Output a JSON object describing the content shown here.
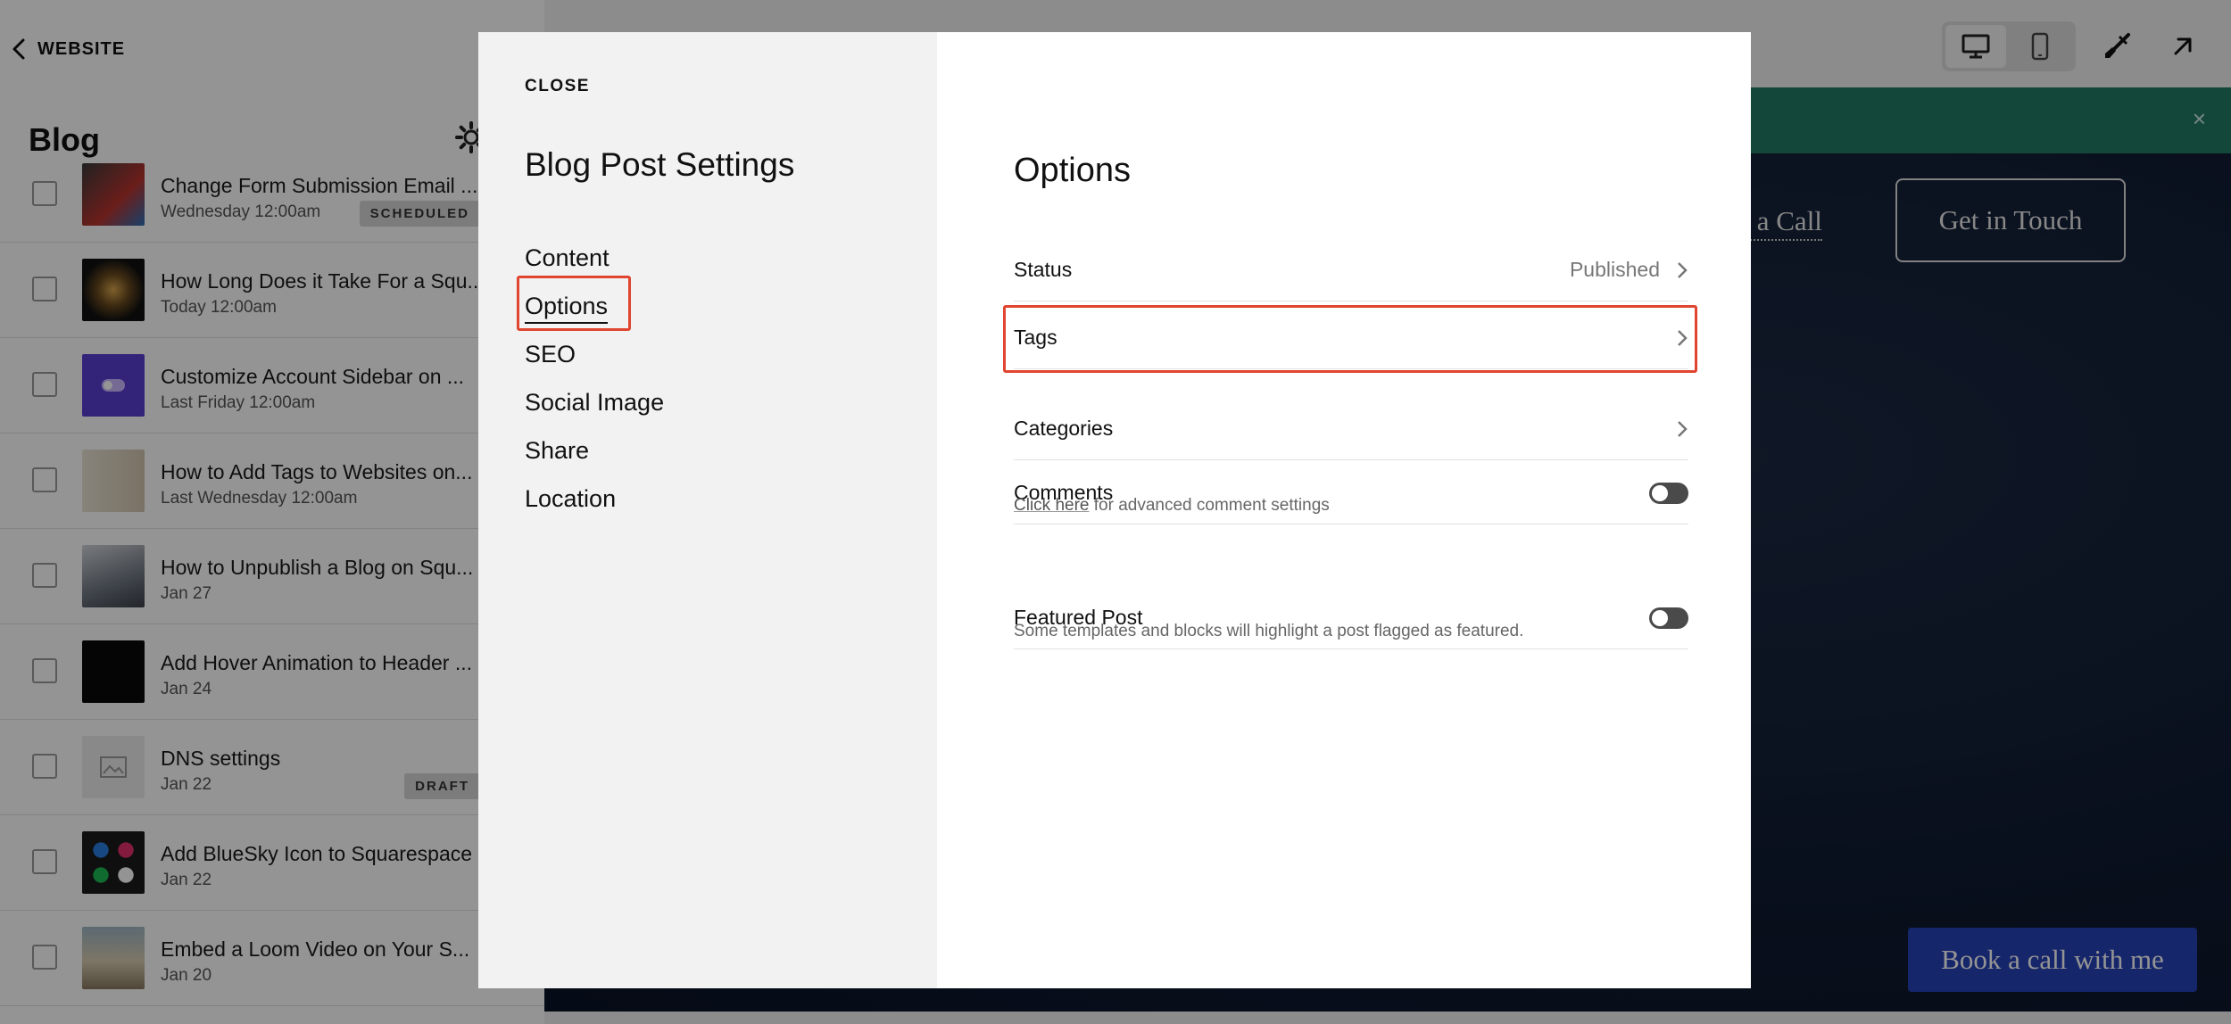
{
  "sidebar": {
    "back_label": "WEBSITE",
    "title": "Blog",
    "posts": [
      {
        "title": "Change Form Submission Email ...",
        "date": "Wednesday 12:00am",
        "badge": "SCHEDULED",
        "thumb": "thumb-email"
      },
      {
        "title": "How Long Does it Take For a Squ...",
        "date": "Today 12:00am",
        "badge": "",
        "thumb": "thumb-clock"
      },
      {
        "title": "Customize Account Sidebar on ...",
        "date": "Last Friday 12:00am",
        "badge": "",
        "thumb": "thumb-toggle"
      },
      {
        "title": "How to Add Tags to Websites on...",
        "date": "Last Wednesday 12:00am",
        "badge": "",
        "thumb": "thumb-tags"
      },
      {
        "title": "How to Unpublish a Blog on Squ...",
        "date": "Jan 27",
        "badge": "",
        "thumb": "thumb-keyboard"
      },
      {
        "title": "Add Hover Animation to Header ...",
        "date": "Jan 24",
        "badge": "",
        "thumb": "thumb-dark"
      },
      {
        "title": "DNS settings",
        "date": "Jan 22",
        "badge": "DRAFT",
        "thumb": "thumb-placeholder"
      },
      {
        "title": "Add BlueSky Icon to Squarespace",
        "date": "Jan 22",
        "badge": "",
        "thumb": "thumb-social"
      },
      {
        "title": "Embed a Loom Video on Your S...",
        "date": "Jan 20",
        "badge": "",
        "thumb": "thumb-desk"
      }
    ]
  },
  "preview": {
    "nav_call": "ok a Call",
    "nav_touch": "Get in Touch",
    "cta": "Book a call with me",
    "announcement_color": "#1f7a62",
    "cta_color": "#2742b8"
  },
  "modal": {
    "close_label": "CLOSE",
    "title": "Blog Post Settings",
    "nav": [
      "Content",
      "Options",
      "SEO",
      "Social Image",
      "Share",
      "Location"
    ],
    "active_nav": "Options",
    "section_title": "Options",
    "status_label": "Status",
    "status_value": "Published",
    "tags_label": "Tags",
    "categories_label": "Categories",
    "comments_label": "Comments",
    "comments_help_link": "Click here",
    "comments_help_rest": " for advanced comment settings",
    "featured_label": "Featured Post",
    "featured_help": "Some templates and blocks will highlight a post flagged as featured.",
    "highlight_color": "#e0452f"
  }
}
